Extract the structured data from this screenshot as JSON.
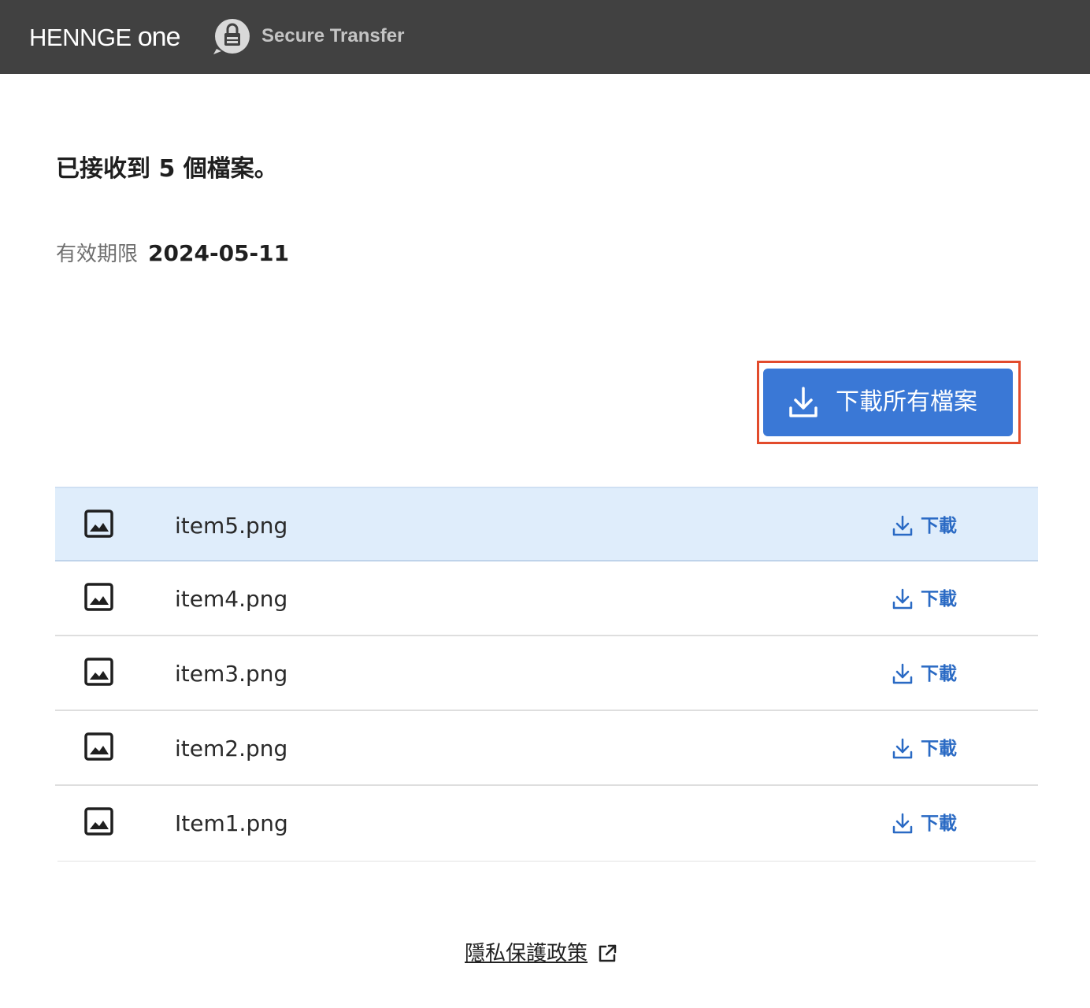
{
  "header": {
    "brand_name": "HENNGE",
    "brand_suffix": "one",
    "product_name": "Secure Transfer",
    "product_icon": "lock-bubble-icon",
    "background_color": "#414141"
  },
  "summary": {
    "received_text": "已接收到 5 個檔案。",
    "expiry_label": "有效期限",
    "expiry_date": "2024-05-11"
  },
  "actions": {
    "download_all_label": "下載所有檔案",
    "download_all_icon": "download-icon",
    "accent_color": "#3a78d6"
  },
  "files": [
    {
      "name": "item5.png",
      "icon": "image-file-icon",
      "download_label": "下載",
      "selected": true
    },
    {
      "name": "item4.png",
      "icon": "image-file-icon",
      "download_label": "下載",
      "selected": false
    },
    {
      "name": "item3.png",
      "icon": "image-file-icon",
      "download_label": "下載",
      "selected": false
    },
    {
      "name": "item2.png",
      "icon": "image-file-icon",
      "download_label": "下載",
      "selected": false
    },
    {
      "name": "Item1.png",
      "icon": "image-file-icon",
      "download_label": "下載",
      "selected": false
    }
  ],
  "footer": {
    "privacy_label": "隱私保護政策",
    "privacy_icon": "external-link-icon"
  }
}
